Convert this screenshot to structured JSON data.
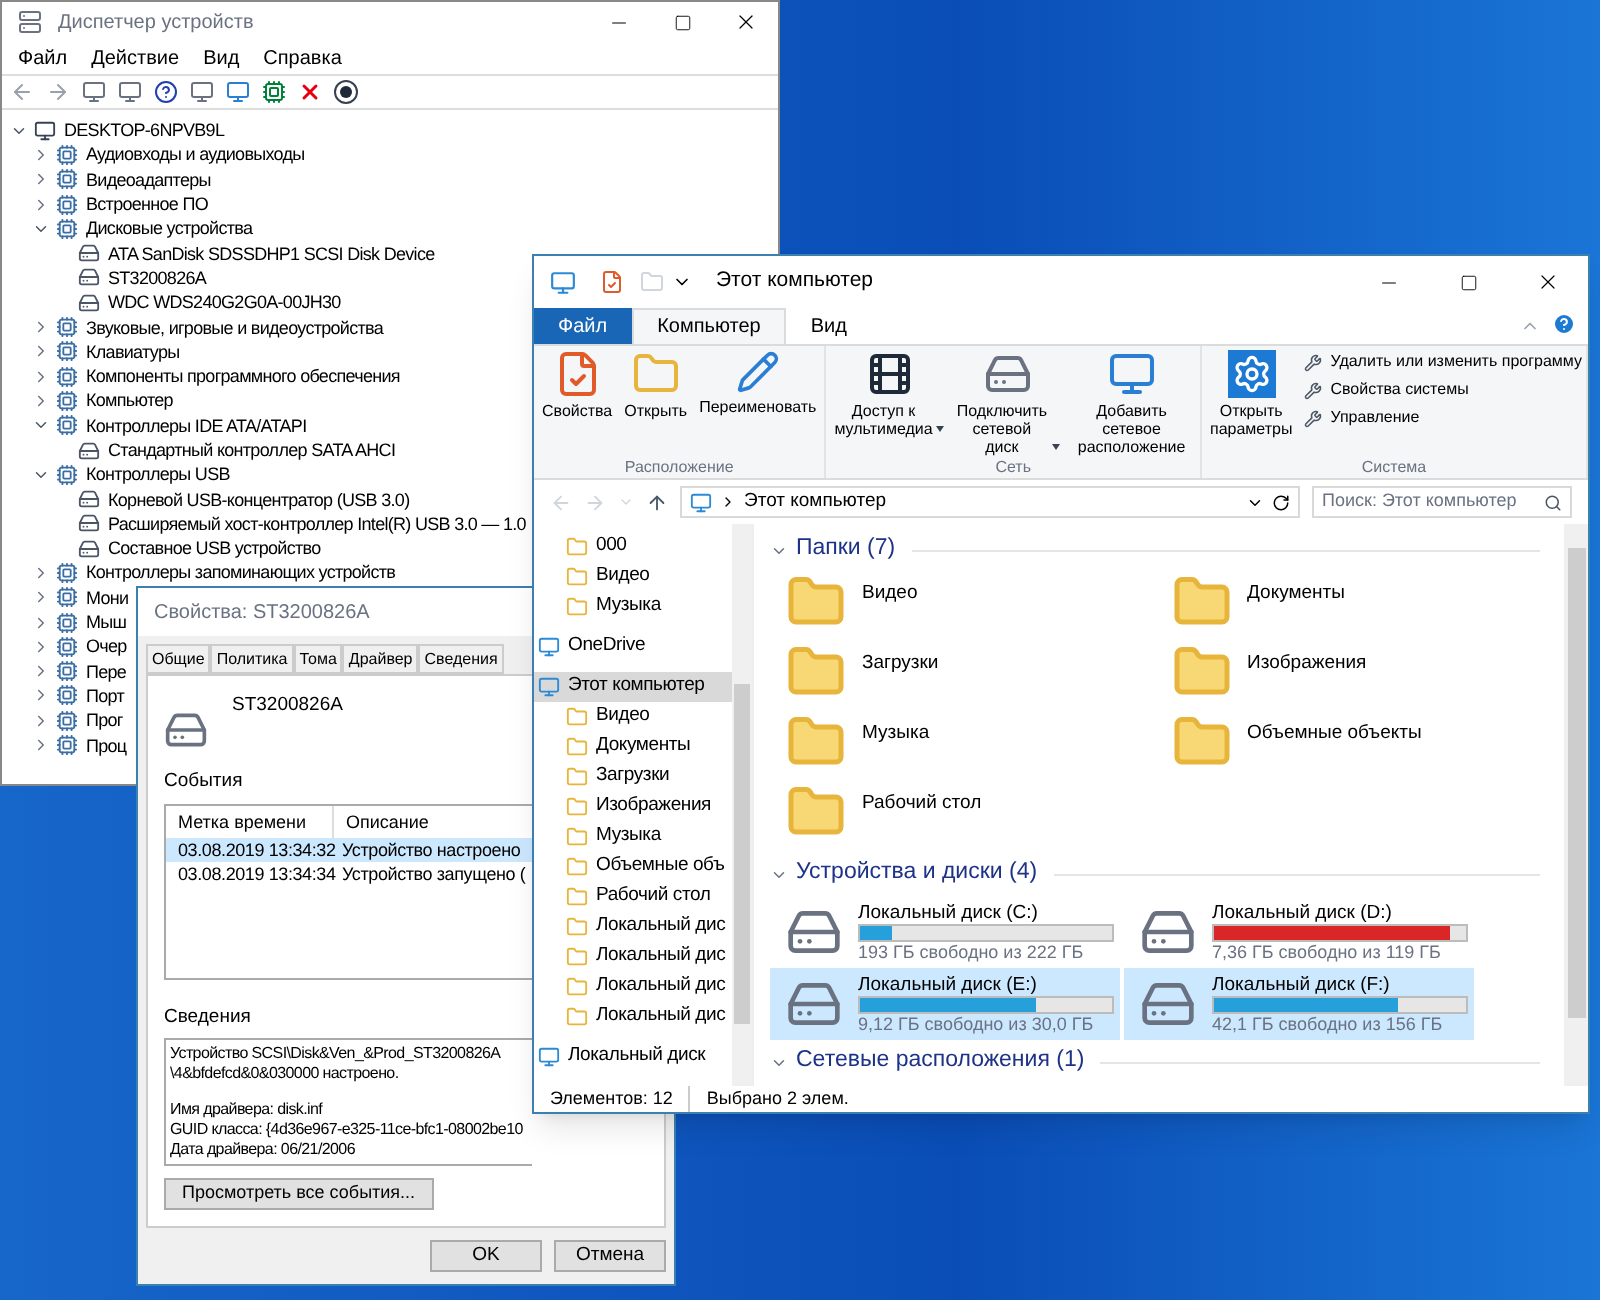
{
  "device_manager": {
    "title": "Диспетчер устройств",
    "menu": [
      "Файл",
      "Действие",
      "Вид",
      "Справка"
    ],
    "tree": {
      "label": "DESKTOP-6NPVB9L",
      "expanded": true,
      "children": [
        {
          "label": "Аудиовходы и аудиовыходы",
          "expanded": false
        },
        {
          "label": "Видеоадаптеры",
          "expanded": false
        },
        {
          "label": "Встроенное ПО",
          "expanded": false
        },
        {
          "label": "Дисковые устройства",
          "expanded": true,
          "children": [
            {
              "label": "ATA SanDisk SDSSDHP1 SCSI Disk Device"
            },
            {
              "label": "ST3200826A"
            },
            {
              "label": "WDC WDS240G2G0A-00JH30"
            }
          ]
        },
        {
          "label": "Звуковые, игровые и видеоустройства",
          "expanded": false
        },
        {
          "label": "Клавиатуры",
          "expanded": false
        },
        {
          "label": "Компоненты программного обеспечения",
          "expanded": false
        },
        {
          "label": "Компьютер",
          "expanded": false
        },
        {
          "label": "Контроллеры IDE ATA/ATAPI",
          "expanded": true,
          "children": [
            {
              "label": "Стандартный контроллер SATA AHCI"
            }
          ]
        },
        {
          "label": "Контроллеры USB",
          "expanded": true,
          "children": [
            {
              "label": "Корневой USB-концентратор (USB 3.0)"
            },
            {
              "label": "Расширяемый хост-контроллер Intel(R) USB 3.0 — 1.0"
            },
            {
              "label": "Составное USB устройство"
            }
          ]
        },
        {
          "label": "Контроллеры запоминающих устройств",
          "expanded": false
        },
        {
          "label": "Мони",
          "expanded": false
        },
        {
          "label": "Мыш",
          "expanded": false
        },
        {
          "label": "Очер",
          "expanded": false
        },
        {
          "label": "Пере",
          "expanded": false
        },
        {
          "label": "Порт",
          "expanded": false
        },
        {
          "label": "Прог",
          "expanded": false
        },
        {
          "label": "Проц",
          "expanded": false
        }
      ]
    }
  },
  "properties_dialog": {
    "title": "Свойства: ST3200826A",
    "tabs": [
      {
        "label": "Общие",
        "selected": false
      },
      {
        "label": "Политика",
        "selected": false
      },
      {
        "label": "Тома",
        "selected": false
      },
      {
        "label": "Драйвер",
        "selected": false
      },
      {
        "label": "Сведения",
        "selected": false
      }
    ],
    "device_name": "ST3200826A",
    "events_label": "События",
    "events_table": {
      "columns": [
        "Метка времени",
        "Описание"
      ],
      "rows": [
        {
          "cells": [
            "03.08.2019 13:34:32",
            "Устройство настроено"
          ],
          "selected": true
        },
        {
          "cells": [
            "03.08.2019 13:34:34",
            "Устройство запущено ("
          ],
          "selected": false
        }
      ]
    },
    "details_label": "Сведения",
    "details_paragraphs": [
      [
        "Устройство SCSI\\Disk&Ven_&Prod_ST3200826A",
        "\\4&bfdefcd&0&030000 настроено."
      ],
      [
        "Имя драйвера: disk.inf",
        "GUID класса: {4d36e967-e325-11ce-bfc1-08002be10",
        "Дата драйвера: 06/21/2006"
      ]
    ],
    "view_all_button": "Просмотреть все события...",
    "buttons": [
      "OK",
      "Отмена"
    ]
  },
  "explorer": {
    "title": "Этот компьютер",
    "ribbon_tabs": [
      {
        "label": "Файл",
        "kind": "file",
        "selected": false
      },
      {
        "label": "Компьютер",
        "kind": "tab",
        "selected": true
      },
      {
        "label": "Вид",
        "kind": "tab",
        "selected": false
      }
    ],
    "ribbon_groups": [
      {
        "label": "Расположение",
        "large": [
          {
            "label": "Свойства"
          },
          {
            "label": "Открыть"
          },
          {
            "label": "Переименовать"
          }
        ]
      },
      {
        "label": "Сеть",
        "large": [
          {
            "label": "Доступ к мультимедиа",
            "dropdown": true
          },
          {
            "label": "Подключить сетевой диск",
            "dropdown": true
          },
          {
            "label": "Добавить сетевое расположение",
            "dropdown": false
          }
        ]
      },
      {
        "label": "Система",
        "large": [
          {
            "label": "Открыть параметры",
            "dropdown": false
          }
        ],
        "small": [
          "Удалить или изменить программу",
          "Свойства системы",
          "Управление"
        ]
      }
    ],
    "address": "Этот компьютер",
    "search_placeholder": "Поиск: Этот компьютер",
    "nav_pane": [
      {
        "children": [
          {
            "label": "000",
            "selected": false
          },
          {
            "label": "Видео",
            "selected": false
          },
          {
            "label": "Музыка",
            "selected": false
          }
        ]
      },
      {
        "label": "OneDrive",
        "selected": false
      },
      {
        "label": "Этот компьютер",
        "selected": true,
        "children": [
          {
            "label": "Видео",
            "selected": false
          },
          {
            "label": "Документы",
            "selected": false
          },
          {
            "label": "Загрузки",
            "selected": false
          },
          {
            "label": "Изображения",
            "selected": false
          },
          {
            "label": "Музыка",
            "selected": false
          },
          {
            "label": "Объемные объ",
            "selected": false
          },
          {
            "label": "Рабочий стол",
            "selected": false
          },
          {
            "label": "Локальный дис",
            "selected": false
          },
          {
            "label": "Локальный дис",
            "selected": false
          },
          {
            "label": "Локальный дис",
            "selected": false
          },
          {
            "label": "Локальный дис",
            "selected": false
          }
        ]
      },
      {
        "label": "Локальный диск",
        "selected": false
      }
    ],
    "sections": [
      {
        "title": "Папки (7)",
        "kind": "folders",
        "items": [
          {
            "label": "Видео"
          },
          {
            "label": "Документы"
          },
          {
            "label": "Загрузки"
          },
          {
            "label": "Изображения"
          },
          {
            "label": "Музыка"
          },
          {
            "label": "Объемные объекты"
          },
          {
            "label": "Рабочий стол"
          }
        ]
      },
      {
        "title": "Устройства и диски (4)",
        "kind": "drives",
        "items": [
          {
            "label": "Локальный диск (C:)",
            "free": "193 ГБ свободно из 222 ГБ",
            "level": 0.13,
            "color": "#26a0da",
            "selected": false
          },
          {
            "label": "Локальный диск (D:)",
            "free": "7,36 ГБ свободно из 119 ГБ",
            "level": 0.94,
            "color": "#da2626",
            "selected": false
          },
          {
            "label": "Локальный диск (E:)",
            "free": "9,12 ГБ свободно из 30,0 ГБ",
            "level": 0.7,
            "color": "#26a0da",
            "selected": true
          },
          {
            "label": "Локальный диск (F:)",
            "free": "42,1 ГБ свободно из 156 ГБ",
            "level": 0.73,
            "color": "#26a0da",
            "selected": true
          }
        ]
      },
      {
        "title": "Сетевые расположения (1)",
        "kind": "network"
      }
    ],
    "status": [
      "Элементов: 12",
      "Выбрано 2 элем."
    ]
  }
}
